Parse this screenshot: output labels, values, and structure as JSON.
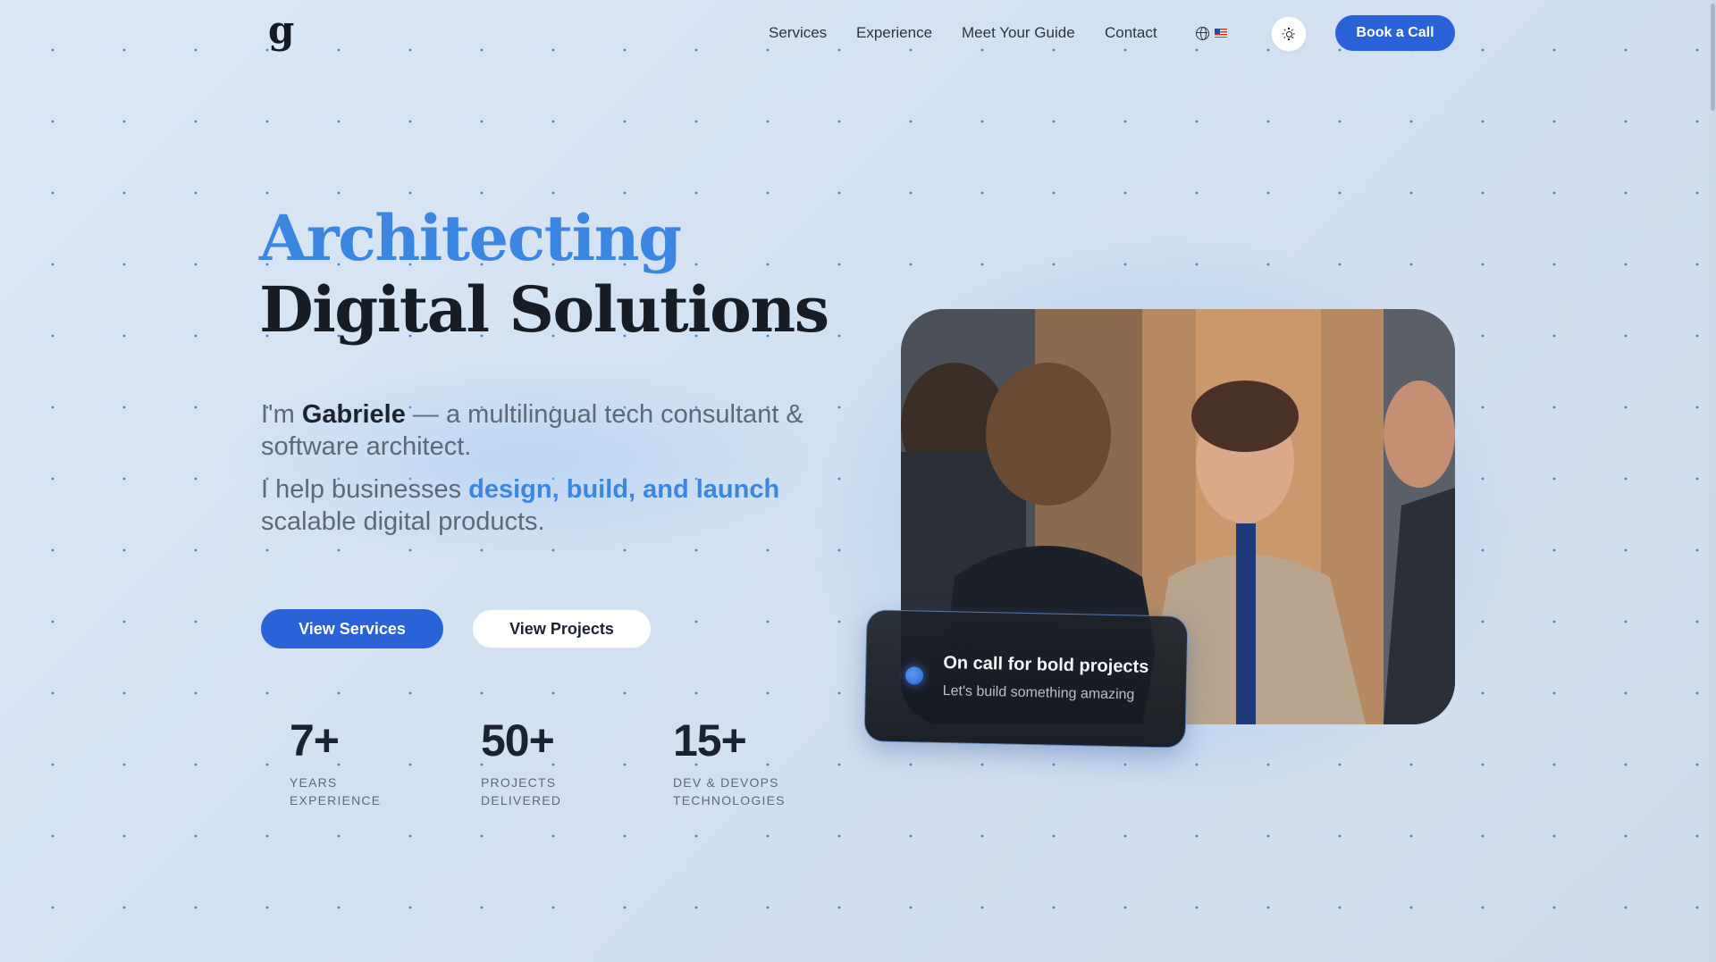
{
  "nav": {
    "logo": "g",
    "links": [
      "Services",
      "Experience",
      "Meet Your Guide",
      "Contact"
    ],
    "language_icon": "globe-icon",
    "flag_icon": "us-flag-icon",
    "theme_icon": "sun-icon",
    "cta": "Book a Call"
  },
  "hero": {
    "title_line1": "Architecting",
    "title_line2": "Digital Solutions",
    "intro_prefix": "I'm ",
    "intro_name": "Gabriele",
    "intro_rest": " — a multilingual tech consultant & software architect.",
    "intro2_prefix": "I help businesses ",
    "intro2_highlight": "design, build, and launch",
    "intro2_rest": " scalable digital products.",
    "primary_button": "View Services",
    "secondary_button": "View Projects"
  },
  "stats": [
    {
      "value": "7+",
      "label": "YEARS\nEXPERIENCE"
    },
    {
      "value": "50+",
      "label": "PROJECTS\nDELIVERED"
    },
    {
      "value": "15+",
      "label": "DEV & DEVOPS\nTECHNOLOGIES"
    }
  ],
  "callout": {
    "title": "On call for bold projects",
    "subtitle": "Let's build something amazing"
  },
  "colors": {
    "accent": "#3a86e0",
    "primary_button": "#2a62d8",
    "heading": "#171d26"
  }
}
